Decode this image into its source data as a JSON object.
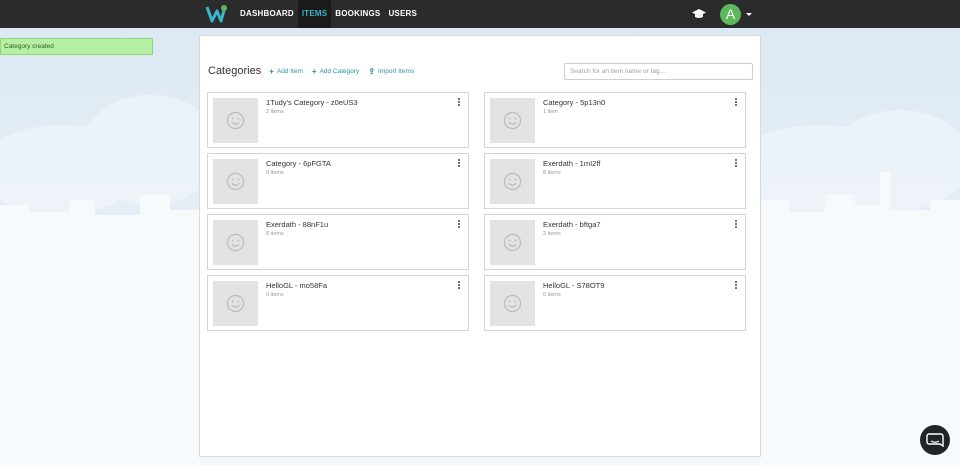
{
  "nav": {
    "items": [
      {
        "label": "DASHBOARD",
        "active": false
      },
      {
        "label": "ITEMS",
        "active": true
      },
      {
        "label": "BOOKINGS",
        "active": false
      },
      {
        "label": "USERS",
        "active": false
      }
    ],
    "avatar_letter": "A",
    "avatar_color": "#5cb85c"
  },
  "toast": {
    "message": "Category created"
  },
  "page": {
    "title": "Categories",
    "add_item": "Add Item",
    "add_category": "Add Category",
    "import_items": "Import Items",
    "search_placeholder": "Search for an item name or tag..."
  },
  "categories": [
    {
      "name": "1Tudy's Category - z0eUS3",
      "count": "2 items"
    },
    {
      "name": "Category - 5p13n0",
      "count": "1 item"
    },
    {
      "name": "Category - 6pFGTA",
      "count": "0 items"
    },
    {
      "name": "Exerdath - 1mI2ff",
      "count": "8 items"
    },
    {
      "name": "Exerdath - 88nF1u",
      "count": "8 items"
    },
    {
      "name": "Exerdath - bftga7",
      "count": "2 items"
    },
    {
      "name": "HelloGL - mo58Fa",
      "count": "0 items"
    },
    {
      "name": "HelloGL - S78OT9",
      "count": "0 items"
    }
  ],
  "colors": {
    "accent": "#39b6c9",
    "link": "#2a8fb0",
    "topbar": "#2b2b2b",
    "toast": "#b6f0a4"
  }
}
